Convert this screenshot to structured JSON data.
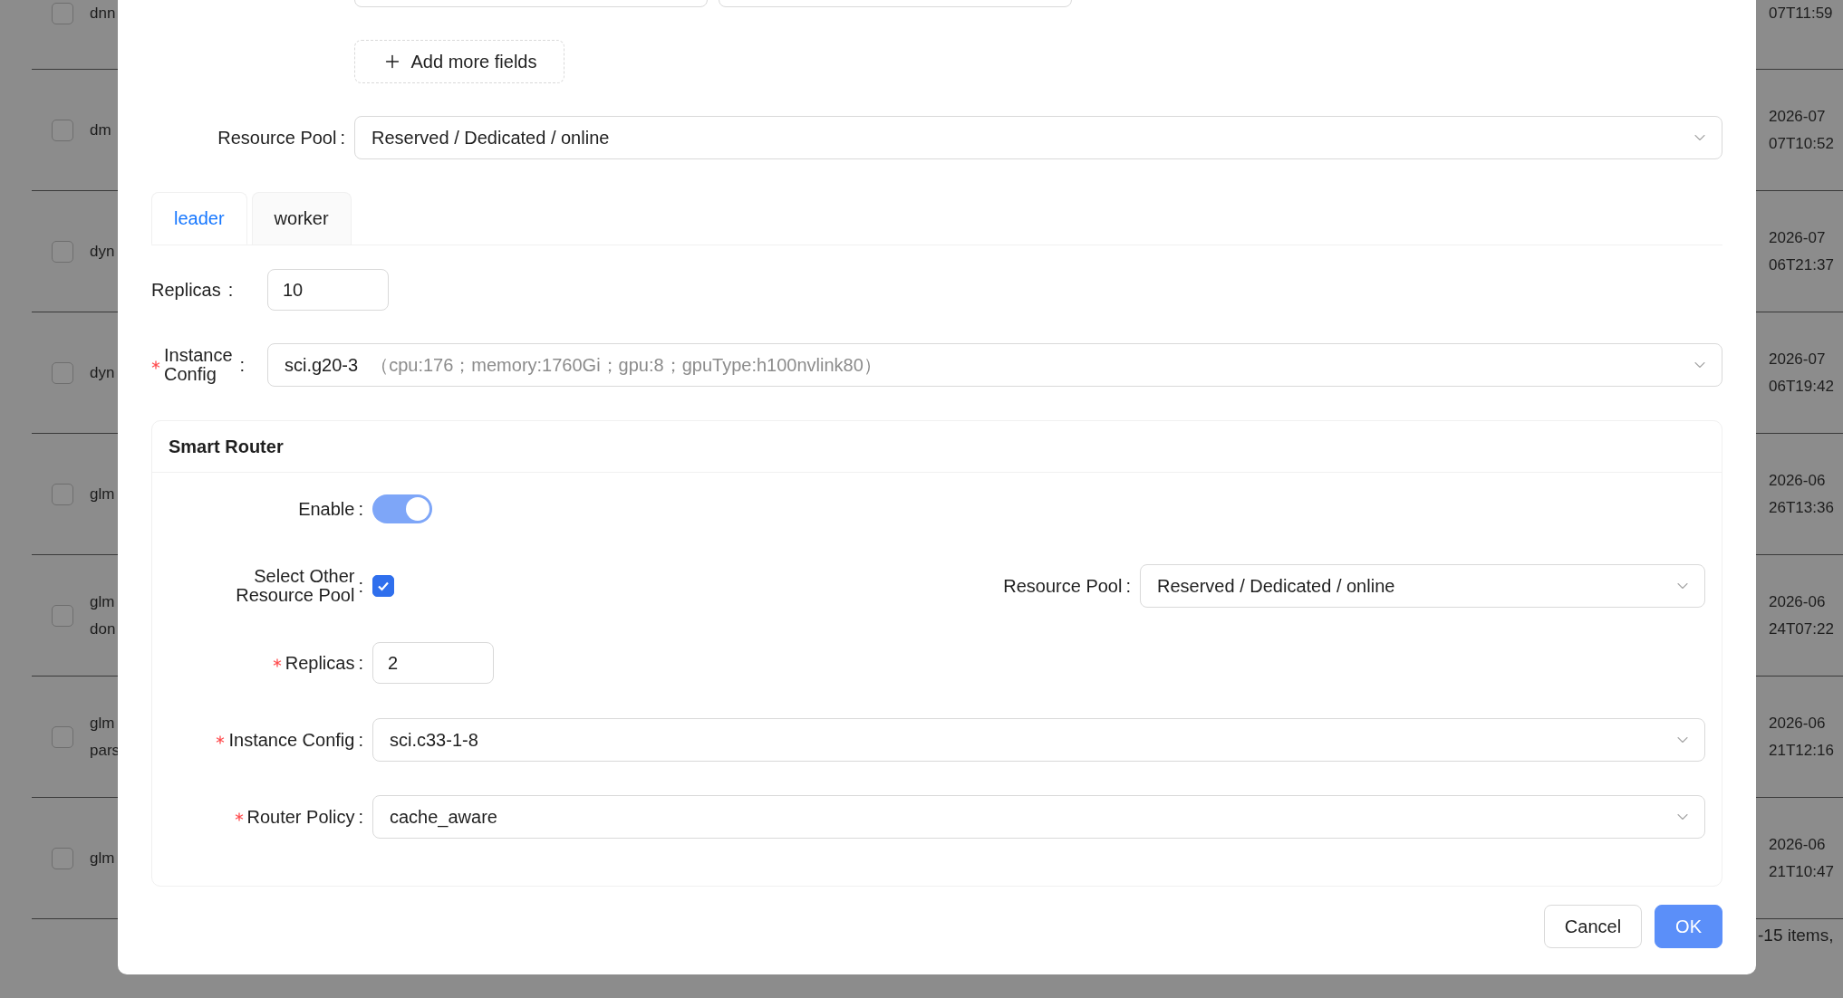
{
  "background_table": {
    "rows": [
      {
        "checked": false,
        "name": [
          "dnn"
        ],
        "date": [
          "07T11:59"
        ]
      },
      {
        "checked": false,
        "name": [
          "dm"
        ],
        "date": [
          "2026-07",
          "07T10:52"
        ]
      },
      {
        "checked": false,
        "name": [
          "dyn"
        ],
        "date": [
          "2026-07",
          "06T21:37"
        ]
      },
      {
        "checked": false,
        "name": [
          "dyn"
        ],
        "date": [
          "2026-07",
          "06T19:42"
        ]
      },
      {
        "checked": false,
        "name": [
          "glm"
        ],
        "date": [
          "2026-06",
          "26T13:36"
        ]
      },
      {
        "checked": false,
        "name": [
          "glm",
          "don"
        ],
        "date": [
          "2026-06",
          "24T07:22"
        ]
      },
      {
        "checked": false,
        "name": [
          "glm",
          "pars"
        ],
        "date": [
          "2026-06",
          "21T12:16"
        ]
      },
      {
        "checked": false,
        "name": [
          "glm"
        ],
        "date": [
          "2026-06",
          "21T10:47"
        ]
      }
    ],
    "footer": "-15 items,"
  },
  "modal": {
    "add_fields_button": "Add more fields",
    "resource_pool": {
      "label": "Resource Pool",
      "colon": ":",
      "value": "Reserved / Dedicated / online"
    },
    "tabs": [
      {
        "label": "leader",
        "selected": true
      },
      {
        "label": "worker",
        "selected": false
      }
    ],
    "replicas": {
      "label": "Replicas",
      "colon": ":",
      "required": false,
      "value": "10"
    },
    "instance_config": {
      "label_lines": [
        "Instance",
        "Config"
      ],
      "colon": ":",
      "required": true,
      "value": "sci.g20-3",
      "detail": "（cpu:176；memory:1760Gi；gpu:8；gpuType:h100nvlink80）"
    },
    "smart_router": {
      "title": "Smart Router",
      "fields": [
        {
          "kind": "switch",
          "label_lines": [
            "Enable"
          ],
          "colon": ":",
          "required": false,
          "on": true
        },
        {
          "kind": "checkbox",
          "label_lines": [
            "Select Other",
            "Resource Pool"
          ],
          "colon": ":",
          "required": false,
          "checked": true,
          "side": {
            "label": "Resource Pool",
            "colon": ":",
            "value": "Reserved / Dedicated / online"
          }
        },
        {
          "kind": "input",
          "label_lines": [
            "Replicas"
          ],
          "colon": ":",
          "required": true,
          "value": "2"
        },
        {
          "kind": "select",
          "label_lines": [
            "Instance Config"
          ],
          "colon": ":",
          "required": true,
          "value": "sci.c33-1-8"
        },
        {
          "kind": "select",
          "label_lines": [
            "Router Policy"
          ],
          "colon": ":",
          "required": true,
          "value": "cache_aware"
        }
      ]
    },
    "buttons": [
      {
        "label": "Cancel",
        "kind": "default"
      },
      {
        "label": "OK",
        "kind": "primary"
      }
    ]
  }
}
